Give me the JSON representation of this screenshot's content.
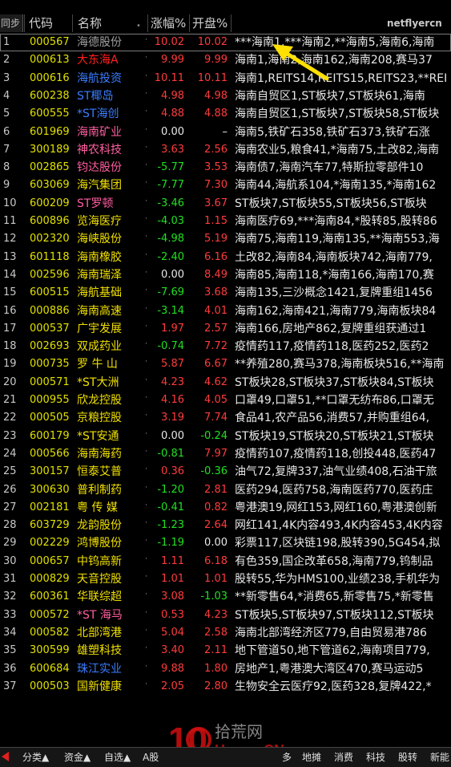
{
  "header": {
    "sync": "同步",
    "code": "代码",
    "name": "名称",
    "name_marker": "•",
    "change": "涨幅%",
    "open": "开盘%",
    "concept_tag": "netflyercn"
  },
  "colors": {
    "up": "#ff3b3b",
    "down": "#20e020",
    "flat": "#e8e8e8",
    "code": "#e0e000",
    "name": "#f0e000",
    "highlight_name_red": "#ff2020",
    "highlight_name_blue": "#3a7dff",
    "highlight_name_pink": "#ff5fa0"
  },
  "rows": [
    {
      "idx": "1",
      "code": "000567",
      "name": "海德股份",
      "name_color": "gray",
      "chg": "10.02",
      "chg_dir": "up",
      "open": "10.02",
      "open_dir": "up",
      "concept": "***海南1,***海南2,**海南5,海南6,海南"
    },
    {
      "idx": "2",
      "code": "000613",
      "name": "大东海A",
      "name_color": "red",
      "chg": "9.99",
      "chg_dir": "up",
      "open": "9.99",
      "open_dir": "up",
      "concept": "海南1,海南2,海南162,海南208,赛马37"
    },
    {
      "idx": "3",
      "code": "000616",
      "name": "海航投资",
      "name_color": "blue",
      "chg": "10.11",
      "chg_dir": "up",
      "open": "10.11",
      "open_dir": "up",
      "concept": "海南1,REITS14,REITS15,REITS23,**REI"
    },
    {
      "idx": "4",
      "code": "600238",
      "name": "ST椰岛",
      "name_color": "blue",
      "chg": "4.98",
      "chg_dir": "up",
      "open": "4.98",
      "open_dir": "up",
      "concept": "海南自贸区1,ST板块7,ST板块61,海南"
    },
    {
      "idx": "5",
      "code": "600555",
      "name": "*ST海创",
      "name_color": "blue",
      "chg": "4.88",
      "chg_dir": "up",
      "open": "4.88",
      "open_dir": "up",
      "concept": "海南自贸区1,ST板块7,ST板块58,ST板块"
    },
    {
      "idx": "6",
      "code": "601969",
      "name": "海南矿业",
      "name_color": "pink",
      "chg": "0.00",
      "chg_dir": "flat",
      "open": "–",
      "open_dir": "flat",
      "concept": "海南5,铁矿石358,铁矿石373,铁矿石涨"
    },
    {
      "idx": "7",
      "code": "300189",
      "name": "神农科技",
      "name_color": "pink",
      "chg": "3.63",
      "chg_dir": "up",
      "open": "2.56",
      "open_dir": "up",
      "concept": "海南农业5,粮食41,*海南75,土改82,海南"
    },
    {
      "idx": "8",
      "code": "002865",
      "name": "钧达股份",
      "name_color": "pink",
      "chg": "-5.77",
      "chg_dir": "down",
      "open": "3.53",
      "open_dir": "up",
      "concept": "海南债7,海南汽车77,特斯拉零部件10"
    },
    {
      "idx": "9",
      "code": "603069",
      "name": "海汽集团",
      "name_color": "yellow",
      "chg": "-7.77",
      "chg_dir": "down",
      "open": "7.30",
      "open_dir": "up",
      "concept": "海南44,海航系104,*海南135,*海南162"
    },
    {
      "idx": "10",
      "code": "600209",
      "name": "ST罗顿",
      "name_color": "pink",
      "chg": "-3.46",
      "chg_dir": "down",
      "open": "3.67",
      "open_dir": "up",
      "concept": "ST板块7,ST板块55,ST板块56,ST板块"
    },
    {
      "idx": "11",
      "code": "600896",
      "name": "览海医疗",
      "name_color": "yellow",
      "chg": "-4.03",
      "chg_dir": "down",
      "open": "1.15",
      "open_dir": "up",
      "concept": "海南医疗69,***海南84,*股转85,股转86"
    },
    {
      "idx": "12",
      "code": "002320",
      "name": "海峡股份",
      "name_color": "yellow",
      "chg": "-4.98",
      "chg_dir": "down",
      "open": "5.19",
      "open_dir": "up",
      "concept": "海南75,海南119,海南135,**海南553,海"
    },
    {
      "idx": "13",
      "code": "601118",
      "name": "海南橡胶",
      "name_color": "yellow",
      "chg": "-2.40",
      "chg_dir": "down",
      "open": "6.16",
      "open_dir": "up",
      "concept": "土改82,海南84,海南板块742,海南779,"
    },
    {
      "idx": "14",
      "code": "002596",
      "name": "海南瑞泽",
      "name_color": "yellow",
      "chg": "0.00",
      "chg_dir": "flat",
      "open": "8.49",
      "open_dir": "up",
      "concept": "海南85,海南118,*海南166,海南170,赛"
    },
    {
      "idx": "15",
      "code": "600515",
      "name": "海航基础",
      "name_color": "yellow",
      "chg": "-7.69",
      "chg_dir": "down",
      "open": "3.68",
      "open_dir": "up",
      "concept": "海南135,三沙概念1421,复牌重组1456"
    },
    {
      "idx": "16",
      "code": "000886",
      "name": "海南高速",
      "name_color": "yellow",
      "chg": "-3.14",
      "chg_dir": "down",
      "open": "4.01",
      "open_dir": "up",
      "concept": "海南162,海南421,海南779,海南板块84"
    },
    {
      "idx": "17",
      "code": "000537",
      "name": "广宇发展",
      "name_color": "yellow",
      "chg": "1.97",
      "chg_dir": "up",
      "open": "2.57",
      "open_dir": "up",
      "concept": "海南166,房地产862,复牌重组获通过1"
    },
    {
      "idx": "18",
      "code": "002693",
      "name": "双成药业",
      "name_color": "yellow",
      "chg": "-0.74",
      "chg_dir": "down",
      "open": "7.72",
      "open_dir": "up",
      "concept": "疫情药117,疫情药118,医药252,医药2"
    },
    {
      "idx": "19",
      "code": "000735",
      "name": "罗 牛 山",
      "name_color": "yellow",
      "chg": "5.87",
      "chg_dir": "up",
      "open": "6.67",
      "open_dir": "up",
      "concept": "**养殖280,赛马378,海南板块516,**海南"
    },
    {
      "idx": "20",
      "code": "000571",
      "name": "*ST大洲",
      "name_color": "yellow",
      "chg": "4.23",
      "chg_dir": "up",
      "open": "4.62",
      "open_dir": "up",
      "concept": "ST板块28,ST板块37,ST板块84,ST板块"
    },
    {
      "idx": "21",
      "code": "000955",
      "name": "欣龙控股",
      "name_color": "yellow",
      "chg": "4.16",
      "chg_dir": "up",
      "open": "4.05",
      "open_dir": "up",
      "concept": "口罩49,口罩51,**口罩无纺布86,口罩无"
    },
    {
      "idx": "22",
      "code": "000505",
      "name": "京粮控股",
      "name_color": "yellow",
      "chg": "3.19",
      "chg_dir": "up",
      "open": "7.74",
      "open_dir": "up",
      "concept": "食品41,农产品56,消费57,并购重组64,"
    },
    {
      "idx": "23",
      "code": "600179",
      "name": "*ST安通",
      "name_color": "yellow",
      "chg": "0.00",
      "chg_dir": "flat",
      "open": "-0.24",
      "open_dir": "down",
      "concept": "ST板块19,ST板块20,ST板块21,ST板块"
    },
    {
      "idx": "24",
      "code": "000566",
      "name": "海南海药",
      "name_color": "yellow",
      "chg": "-0.81",
      "chg_dir": "down",
      "open": "7.97",
      "open_dir": "up",
      "concept": "疫情药107,疫情药118,创投448,医药47"
    },
    {
      "idx": "25",
      "code": "300157",
      "name": "恒泰艾普",
      "name_color": "yellow",
      "chg": "0.36",
      "chg_dir": "up",
      "open": "-0.36",
      "open_dir": "down",
      "concept": "油气72,复牌337,油气业绩408,石油干旅"
    },
    {
      "idx": "26",
      "code": "300630",
      "name": "普利制药",
      "name_color": "yellow",
      "chg": "-1.20",
      "chg_dir": "down",
      "open": "2.81",
      "open_dir": "up",
      "concept": "医药294,医药758,海南医药770,医药庄"
    },
    {
      "idx": "27",
      "code": "002181",
      "name": "粤 传 媒",
      "name_color": "yellow",
      "chg": "-0.41",
      "chg_dir": "down",
      "open": "0.82",
      "open_dir": "up",
      "concept": "粤港澳19,网红153,网红160,粤港澳创新"
    },
    {
      "idx": "28",
      "code": "603729",
      "code_color": "",
      "name": "龙韵股份",
      "name_color": "yellow",
      "chg": "-1.23",
      "chg_dir": "down",
      "open": "2.64",
      "open_dir": "up",
      "concept": "网红141,4K内容493,4K内容453,4K内容"
    },
    {
      "idx": "29",
      "code": "002229",
      "name": "鸿博股份",
      "name_color": "yellow",
      "chg": "-1.19",
      "chg_dir": "down",
      "open": "0.00",
      "open_dir": "flat",
      "concept": "彩票117,区块链198,股转390,5G454,拟"
    },
    {
      "idx": "30",
      "code": "000657",
      "name": "中钨高新",
      "name_color": "yellow",
      "chg": "1.11",
      "chg_dir": "up",
      "open": "6.18",
      "open_dir": "up",
      "concept": "有色359,国企改革658,海南779,钨制品"
    },
    {
      "idx": "31",
      "code": "000829",
      "name": "天音控股",
      "name_color": "yellow",
      "chg": "1.01",
      "chg_dir": "up",
      "open": "1.01",
      "open_dir": "up",
      "concept": "股转55,华为HMS100,业绩238,手机华为"
    },
    {
      "idx": "32",
      "code": "600361",
      "name": "华联综超",
      "name_color": "yellow",
      "chg": "3.08",
      "chg_dir": "up",
      "open": "-1.03",
      "open_dir": "down",
      "concept": "**新零售64,*消费65,新零售75,*新零售"
    },
    {
      "idx": "33",
      "code": "000572",
      "name": "*ST 海马",
      "name_color": "pink",
      "chg": "0.53",
      "chg_dir": "up",
      "open": "4.23",
      "open_dir": "up",
      "concept": "ST板块5,ST板块97,ST板块112,ST板块"
    },
    {
      "idx": "34",
      "code": "000582",
      "name": "北部湾港",
      "name_color": "yellow",
      "chg": "5.04",
      "chg_dir": "up",
      "open": "2.58",
      "open_dir": "up",
      "concept": "海南北部湾经济区779,自由贸易港786"
    },
    {
      "idx": "35",
      "code": "300599",
      "name": "雄塑科技",
      "name_color": "yellow",
      "chg": "3.40",
      "chg_dir": "up",
      "open": "2.11",
      "open_dir": "up",
      "concept": "地下管道50,地下管道62,海南项目779,"
    },
    {
      "idx": "36",
      "code": "600684",
      "name": "珠江实业",
      "name_color": "blue",
      "chg": "9.88",
      "chg_dir": "up",
      "open": "1.80",
      "open_dir": "up",
      "concept": "房地产1,粤港澳大湾区470,赛马运动5"
    },
    {
      "idx": "37",
      "code": "000503",
      "name": "国新健康",
      "name_color": "yellow",
      "chg": "2.05",
      "chg_dir": "up",
      "open": "2.80",
      "open_dir": "up",
      "concept": "生物安全云医疗92,医药328,复牌422,*"
    }
  ],
  "bottom_tabs": [
    {
      "label": "分类▲"
    },
    {
      "label": "资金▲"
    },
    {
      "label": "自选▲"
    },
    {
      "label": "A股"
    },
    {
      "label": "多"
    },
    {
      "label": "地摊"
    },
    {
      "label": "消费"
    },
    {
      "label": "科技"
    },
    {
      "label": "股转"
    },
    {
      "label": "新能"
    }
  ],
  "watermark": {
    "number": "10",
    "text_top": "拾荒网",
    "text_bottom": "Huang.CN"
  }
}
